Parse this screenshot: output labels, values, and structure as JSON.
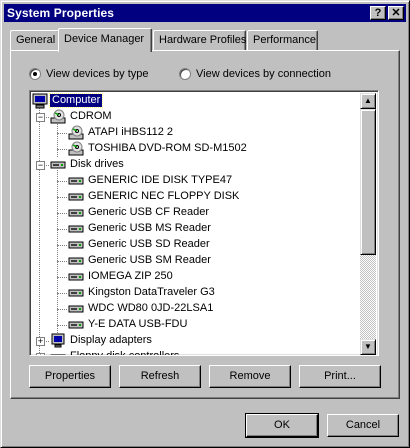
{
  "window": {
    "title": "System Properties"
  },
  "titlebar": {
    "help_glyph": "?",
    "close_glyph": "✕"
  },
  "tabs": [
    {
      "label": "General"
    },
    {
      "label": "Device Manager"
    },
    {
      "label": "Hardware Profiles"
    },
    {
      "label": "Performance"
    }
  ],
  "view_options": {
    "by_type": "View devices by type",
    "by_connection": "View devices by connection",
    "selected": "by_type"
  },
  "tree": {
    "rows": [
      {
        "label": "Computer",
        "level": 0,
        "expander": "minus",
        "icon": "computer-icon",
        "selected": true
      },
      {
        "label": "CDROM",
        "level": 1,
        "expander": "minus",
        "icon": "cdrom-icon"
      },
      {
        "label": "ATAPI iHBS112   2",
        "level": 2,
        "icon": "cdrom-icon"
      },
      {
        "label": "TOSHIBA DVD-ROM SD-M1502",
        "level": 2,
        "icon": "cdrom-icon"
      },
      {
        "label": "Disk drives",
        "level": 1,
        "expander": "minus",
        "icon": "disk-drive-icon"
      },
      {
        "label": "GENERIC IDE  DISK TYPE47",
        "level": 2,
        "icon": "disk-drive-icon"
      },
      {
        "label": "GENERIC NEC  FLOPPY DISK",
        "level": 2,
        "icon": "disk-drive-icon"
      },
      {
        "label": "Generic USB CF Reader",
        "level": 2,
        "icon": "disk-drive-icon"
      },
      {
        "label": "Generic USB MS Reader",
        "level": 2,
        "icon": "disk-drive-icon"
      },
      {
        "label": "Generic USB SD Reader",
        "level": 2,
        "icon": "disk-drive-icon"
      },
      {
        "label": "Generic USB SM Reader",
        "level": 2,
        "icon": "disk-drive-icon"
      },
      {
        "label": "IOMEGA ZIP 250",
        "level": 2,
        "icon": "disk-drive-icon"
      },
      {
        "label": "Kingston DataTraveler G3",
        "level": 2,
        "icon": "disk-drive-icon"
      },
      {
        "label": "WDC WD80 0JD-22LSA1",
        "level": 2,
        "icon": "disk-drive-icon"
      },
      {
        "label": "Y-E DATA USB-FDU",
        "level": 2,
        "icon": "disk-drive-icon"
      },
      {
        "label": "Display adapters",
        "level": 1,
        "expander": "plus",
        "icon": "monitor-icon"
      },
      {
        "label": "Floppy disk controllers",
        "level": 1,
        "expander": "plus",
        "icon": "controller-icon"
      }
    ]
  },
  "scrollbar": {
    "up_glyph": "▲",
    "down_glyph": "▼"
  },
  "buttons": {
    "properties": "Properties",
    "refresh": "Refresh",
    "remove": "Remove",
    "print": "Print...",
    "ok": "OK",
    "cancel": "Cancel"
  },
  "colors": {
    "title_bar": "#000080",
    "face": "#c0c0c0",
    "selection": "#000080"
  }
}
